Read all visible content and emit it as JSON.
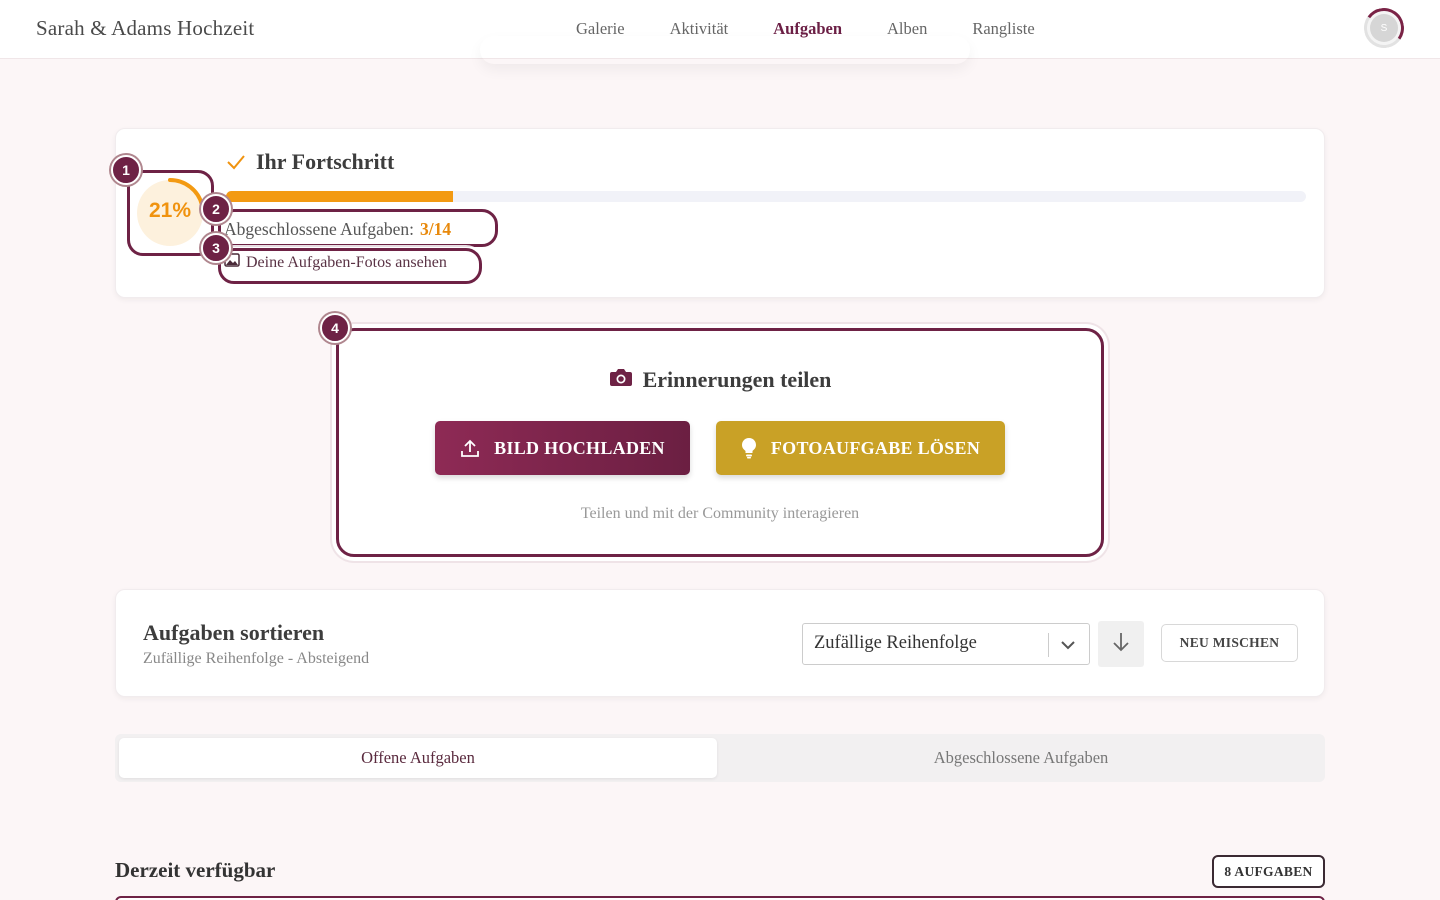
{
  "header": {
    "brand": "Sarah & Adams Hochzeit",
    "nav": [
      "Galerie",
      "Aktivität",
      "Aufgaben",
      "Alben",
      "Rangliste"
    ],
    "active_nav": "Aufgaben",
    "avatar_initial": "S"
  },
  "progress": {
    "title": "Ihr Fortschritt",
    "percent_text": "21%",
    "percent_value": 0.21,
    "completed_label": "Abgeschlossene Aufgaben:",
    "completed_value": "3/14",
    "photos_link": "Deine Aufgaben-Fotos ansehen"
  },
  "highlights": [
    "1",
    "2",
    "3",
    "4"
  ],
  "share": {
    "title": "Erinnerungen teilen",
    "upload_button": "BILD HOCHLADEN",
    "task_button": "FOTOAUFGABE LÖSEN",
    "subtitle": "Teilen und mit der Community interagieren"
  },
  "sort": {
    "title": "Aufgaben sortieren",
    "subtitle": "Zufällige Reihenfolge - Absteigend",
    "select_value": "Zufällige Reihenfolge",
    "shuffle_button": "NEU MISCHEN"
  },
  "tabs": {
    "open": "Offene Aufgaben",
    "done": "Abgeschlossene Aufgaben"
  },
  "section": {
    "title": "Derzeit verfügbar",
    "count_badge": "8 AUFGABEN"
  },
  "colors": {
    "brand": "#6e2245",
    "accent_orange": "#f39a12",
    "gold": "#c9a126",
    "background": "#fcf6f7"
  }
}
